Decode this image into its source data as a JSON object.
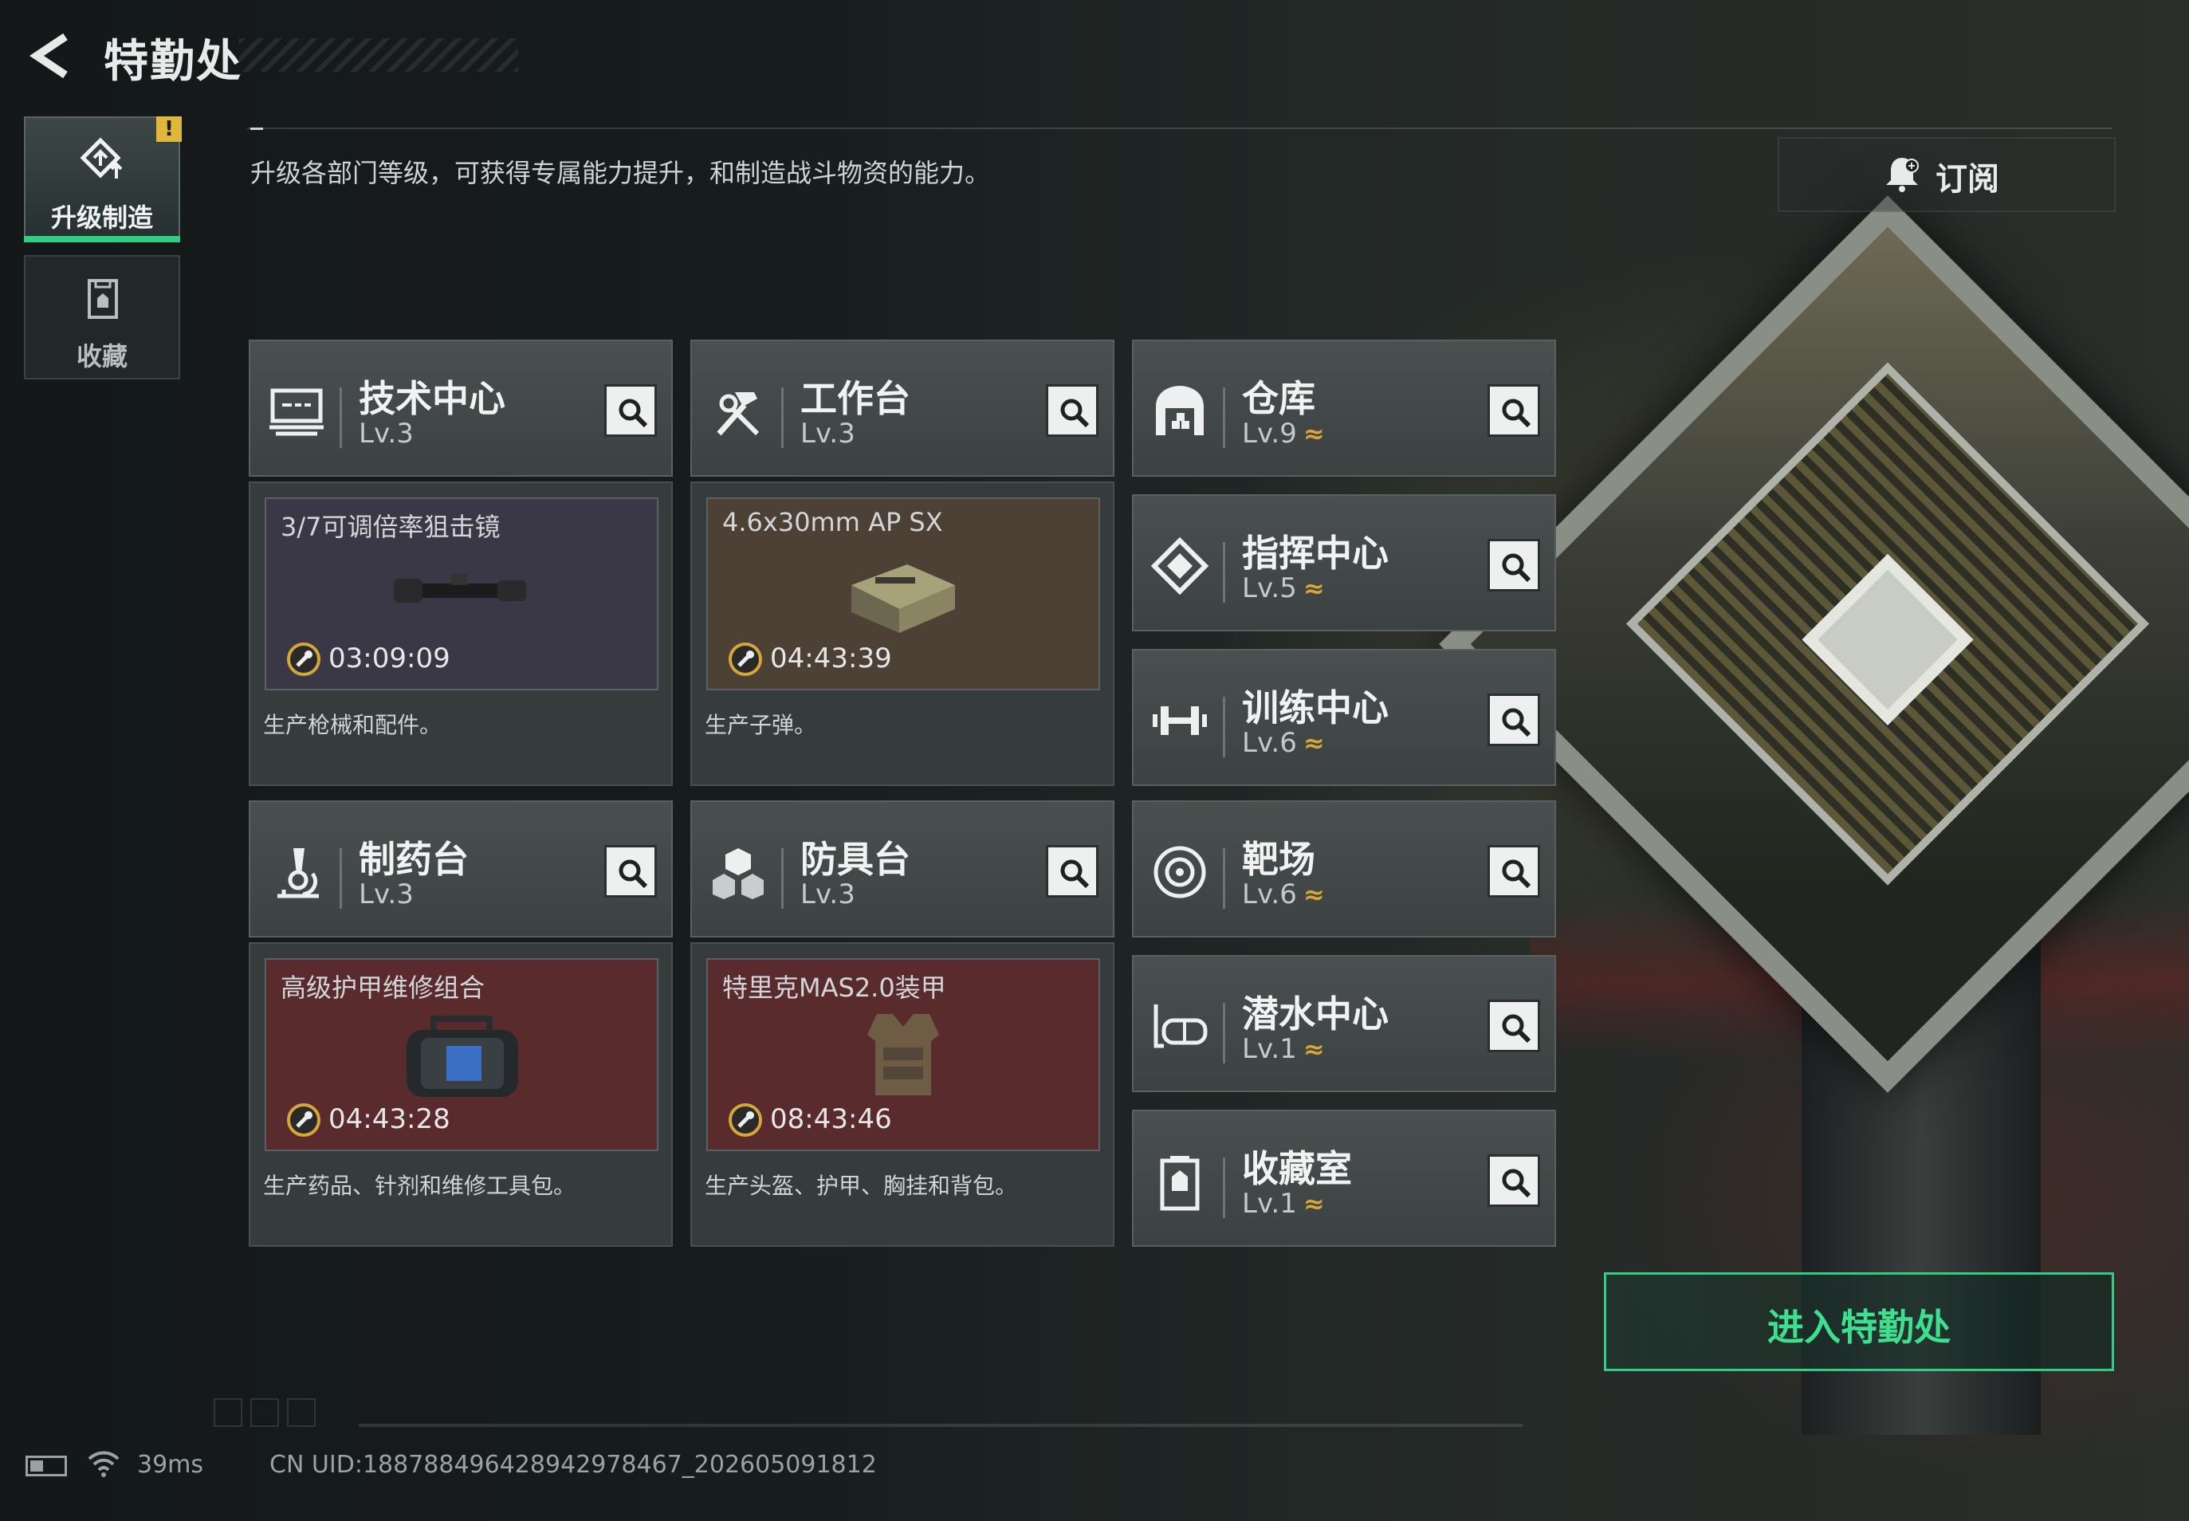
{
  "header": {
    "title": "特勤处",
    "subtitle": "升级各部门等级，可获得专属能力提升，和制造战斗物资的能力。",
    "subscribe_label": "订阅"
  },
  "sidebar": {
    "items": [
      {
        "label": "升级制造",
        "active": true,
        "badge": "!"
      },
      {
        "label": "收藏",
        "active": false
      }
    ]
  },
  "departments": [
    {
      "name": "技术中心",
      "level": "Lv.3",
      "icon": "monitor-icon",
      "production": {
        "item": "3/7可调倍率狙击镜",
        "timer": "03:09:09",
        "bg": "#3a3847"
      },
      "description": "生产枪械和配件。"
    },
    {
      "name": "工作台",
      "level": "Lv.3",
      "icon": "hammer-wrench-icon",
      "production": {
        "item": "4.6x30mm AP SX",
        "timer": "04:43:39",
        "bg": "#4d4035"
      },
      "description": "生产子弹。"
    },
    {
      "name": "制药台",
      "level": "Lv.3",
      "icon": "microscope-icon",
      "production": {
        "item": "高级护甲维修组合",
        "timer": "04:43:28",
        "bg": "#5a2b2d"
      },
      "description": "生产药品、针剂和维修工具包。"
    },
    {
      "name": "防具台",
      "level": "Lv.3",
      "icon": "cubes-icon",
      "production": {
        "item": "特里克MAS2.0装甲",
        "timer": "08:43:46",
        "bg": "#5a2b2d"
      },
      "description": "生产头盔、护甲、胸挂和背包。"
    }
  ],
  "facilities": [
    {
      "name": "仓库",
      "level": "Lv.9",
      "icon": "warehouse-icon",
      "upgradable": true
    },
    {
      "name": "指挥中心",
      "level": "Lv.5",
      "icon": "command-chip-icon",
      "upgradable": true
    },
    {
      "name": "训练中心",
      "level": "Lv.6",
      "icon": "dumbbell-icon",
      "upgradable": true
    },
    {
      "name": "靶场",
      "level": "Lv.6",
      "icon": "target-icon",
      "upgradable": true
    },
    {
      "name": "潜水中心",
      "level": "Lv.1",
      "icon": "diving-mask-icon",
      "upgradable": true
    },
    {
      "name": "收藏室",
      "level": "Lv.1",
      "icon": "trophy-case-icon",
      "upgradable": true
    }
  ],
  "upgrade_symbol": "≈",
  "enter_button": "进入特勤处",
  "status": {
    "ping": "39ms",
    "uid": "CN UID:18878849642894297846​7_202605091812"
  },
  "colors": {
    "accent": "#2fcf83",
    "upgrade": "#d6a63a",
    "badge": "#e0b63c"
  }
}
